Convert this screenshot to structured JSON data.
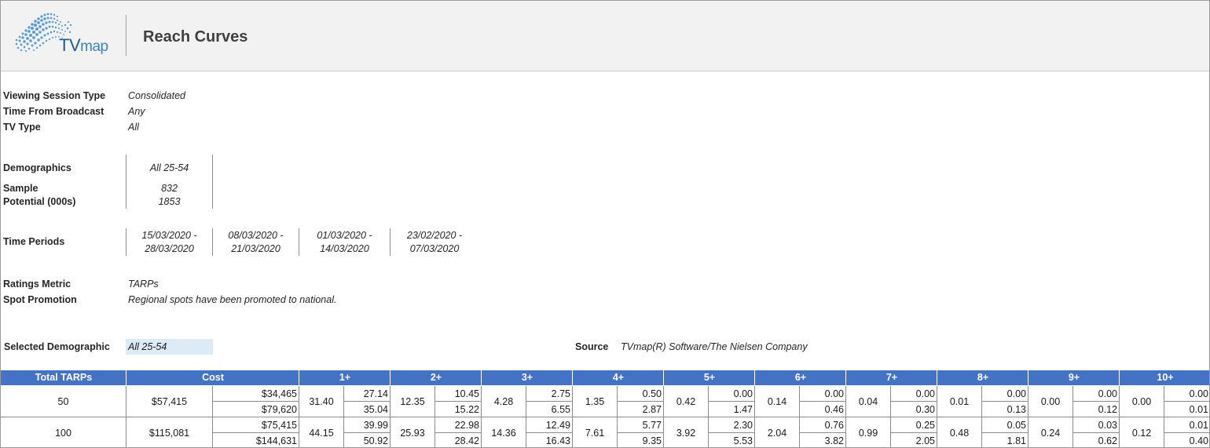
{
  "header": {
    "logo_tv": "TV",
    "logo_map": "map",
    "title": "Reach Curves"
  },
  "settings": {
    "viewing_session_type": {
      "label": "Viewing Session Type",
      "value": "Consolidated"
    },
    "time_from_broadcast": {
      "label": "Time From Broadcast",
      "value": "Any"
    },
    "tv_type": {
      "label": "TV Type",
      "value": "All"
    },
    "demographics": {
      "label": "Demographics",
      "value": "All 25-54"
    },
    "sample": {
      "label": "Sample",
      "value": "832"
    },
    "potential": {
      "label": "Potential (000s)",
      "value": "1853"
    },
    "time_periods": {
      "label": "Time Periods",
      "periods": [
        {
          "start": "15/03/2020 -",
          "end": "28/03/2020"
        },
        {
          "start": "08/03/2020 -",
          "end": "21/03/2020"
        },
        {
          "start": "01/03/2020 -",
          "end": "14/03/2020"
        },
        {
          "start": "23/02/2020 -",
          "end": "07/03/2020"
        }
      ]
    },
    "ratings_metric": {
      "label": "Ratings Metric",
      "value": "TARPs"
    },
    "spot_promotion": {
      "label": "Spot Promotion",
      "value": "Regional spots have been promoted to national."
    },
    "selected_demographic": {
      "label": "Selected Demographic",
      "value": "All 25-54"
    },
    "source": {
      "label": "Source",
      "value": "TVmap(R) Software/The Nielsen Company"
    }
  },
  "table": {
    "headers": {
      "total_tarps": "Total TARPs",
      "cost": "Cost",
      "reach": [
        "1+",
        "2+",
        "3+",
        "4+",
        "5+",
        "6+",
        "7+",
        "8+",
        "9+",
        "10+"
      ]
    },
    "rows": [
      {
        "tarps": "50",
        "cost": "$57,415",
        "cost_low": "$34,465",
        "cost_high": "$79,620",
        "reach": [
          {
            "value": "31.40",
            "low": "27.14",
            "high": "35.04"
          },
          {
            "value": "12.35",
            "low": "10.45",
            "high": "15.22"
          },
          {
            "value": "4.28",
            "low": "2.75",
            "high": "6.55"
          },
          {
            "value": "1.35",
            "low": "0.50",
            "high": "2.87"
          },
          {
            "value": "0.42",
            "low": "0.00",
            "high": "1.47"
          },
          {
            "value": "0.14",
            "low": "0.00",
            "high": "0.46"
          },
          {
            "value": "0.04",
            "low": "0.00",
            "high": "0.30"
          },
          {
            "value": "0.01",
            "low": "0.00",
            "high": "0.13"
          },
          {
            "value": "0.00",
            "low": "0.00",
            "high": "0.12"
          },
          {
            "value": "0.00",
            "low": "0.00",
            "high": "0.01"
          }
        ]
      },
      {
        "tarps": "100",
        "cost": "$115,081",
        "cost_low": "$75,415",
        "cost_high": "$144,631",
        "reach": [
          {
            "value": "44.15",
            "low": "39.99",
            "high": "50.92"
          },
          {
            "value": "25.93",
            "low": "22.98",
            "high": "28.42"
          },
          {
            "value": "14.36",
            "low": "12.49",
            "high": "16.43"
          },
          {
            "value": "7.61",
            "low": "5.77",
            "high": "9.35"
          },
          {
            "value": "3.92",
            "low": "2.30",
            "high": "5.53"
          },
          {
            "value": "2.04",
            "low": "0.76",
            "high": "3.82"
          },
          {
            "value": "0.99",
            "low": "0.25",
            "high": "2.05"
          },
          {
            "value": "0.48",
            "low": "0.05",
            "high": "1.81"
          },
          {
            "value": "0.24",
            "low": "0.03",
            "high": "0.62"
          },
          {
            "value": "0.12",
            "low": "0.01",
            "high": "0.40"
          }
        ]
      }
    ]
  }
}
